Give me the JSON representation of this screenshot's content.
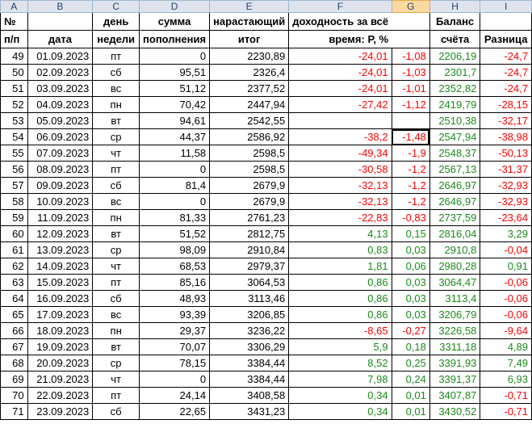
{
  "columns": [
    "A",
    "B",
    "C",
    "D",
    "E",
    "F",
    "G",
    "H",
    "I"
  ],
  "selected_column": "G",
  "header_row1": [
    "№",
    "",
    "день",
    "сумма",
    "нарастающий",
    "доходность за всё",
    "",
    "Баланс",
    ""
  ],
  "header_row2": [
    "п/п",
    "дата",
    "недели",
    "пополнения",
    "итог",
    "время: Р, %",
    "",
    "счёта",
    "Разница"
  ],
  "colors": {
    "negative": "#ff0000",
    "positive": "#1a8a1a",
    "selected_header": "#f9d99f"
  },
  "rows": [
    [
      "49",
      "01.09.2023",
      "пт",
      "0",
      "2230,89",
      "-24,01",
      "-1,08",
      "2206,19",
      "-24,7"
    ],
    [
      "50",
      "02.09.2023",
      "сб",
      "95,51",
      "2326,4",
      "-24,01",
      "-1,03",
      "2301,7",
      "-24,7"
    ],
    [
      "51",
      "03.09.2023",
      "вс",
      "51,12",
      "2377,52",
      "-24,01",
      "-1,01",
      "2352,82",
      "-24,7"
    ],
    [
      "52",
      "04.09.2023",
      "пн",
      "70,42",
      "2447,94",
      "-27,42",
      "-1,12",
      "2419,79",
      "-28,15"
    ],
    [
      "53",
      "05.09.2023",
      "вт",
      "94,61",
      "2542,55",
      "",
      "",
      "2510,38",
      "-32,17"
    ],
    [
      "54",
      "06.09.2023",
      "ср",
      "44,37",
      "2586,92",
      "-38,2",
      "-1,48",
      "2547,94",
      "-38,98"
    ],
    [
      "55",
      "07.09.2023",
      "чт",
      "11,58",
      "2598,5",
      "-49,34",
      "-1,9",
      "2548,37",
      "-50,13"
    ],
    [
      "56",
      "08.09.2023",
      "пт",
      "0",
      "2598,5",
      "-30,58",
      "-1,2",
      "2567,13",
      "-31,37"
    ],
    [
      "57",
      "09.09.2023",
      "сб",
      "81,4",
      "2679,9",
      "-32,13",
      "-1,2",
      "2646,97",
      "-32,93"
    ],
    [
      "58",
      "10.09.2023",
      "вс",
      "0",
      "2679,9",
      "-32,13",
      "-1,2",
      "2646,97",
      "-32,93"
    ],
    [
      "59",
      "11.09.2023",
      "пн",
      "81,33",
      "2761,23",
      "-22,83",
      "-0,83",
      "2737,59",
      "-23,64"
    ],
    [
      "60",
      "12.09.2023",
      "вт",
      "51,52",
      "2812,75",
      "4,13",
      "0,15",
      "2816,04",
      "3,29"
    ],
    [
      "61",
      "13.09.2023",
      "ср",
      "98,09",
      "2910,84",
      "0,83",
      "0,03",
      "2910,8",
      "-0,04"
    ],
    [
      "62",
      "14.09.2023",
      "чт",
      "68,53",
      "2979,37",
      "1,81",
      "0,06",
      "2980,28",
      "0,91"
    ],
    [
      "63",
      "15.09.2023",
      "пт",
      "85,16",
      "3064,53",
      "0,86",
      "0,03",
      "3064,47",
      "-0,06"
    ],
    [
      "64",
      "16.09.2023",
      "сб",
      "48,93",
      "3113,46",
      "0,86",
      "0,03",
      "3113,4",
      "-0,06"
    ],
    [
      "65",
      "17.09.2023",
      "вс",
      "93,39",
      "3206,85",
      "0,86",
      "0,03",
      "3206,79",
      "-0,06"
    ],
    [
      "66",
      "18.09.2023",
      "пн",
      "29,37",
      "3236,22",
      "-8,65",
      "-0,27",
      "3226,58",
      "-9,64"
    ],
    [
      "67",
      "19.09.2023",
      "вт",
      "70,07",
      "3306,29",
      "5,9",
      "0,18",
      "3311,18",
      "4,89"
    ],
    [
      "68",
      "20.09.2023",
      "ср",
      "78,15",
      "3384,44",
      "8,52",
      "0,25",
      "3391,93",
      "7,49"
    ],
    [
      "69",
      "21.09.2023",
      "чт",
      "0",
      "3384,44",
      "7,98",
      "0,24",
      "3391,37",
      "6,93"
    ],
    [
      "70",
      "22.09.2023",
      "пт",
      "24,14",
      "3408,58",
      "0,34",
      "0,01",
      "3407,87",
      "-0,71"
    ],
    [
      "71",
      "23.09.2023",
      "сб",
      "22,65",
      "3431,23",
      "0,34",
      "0,01",
      "3430,52",
      "-0,71"
    ]
  ]
}
